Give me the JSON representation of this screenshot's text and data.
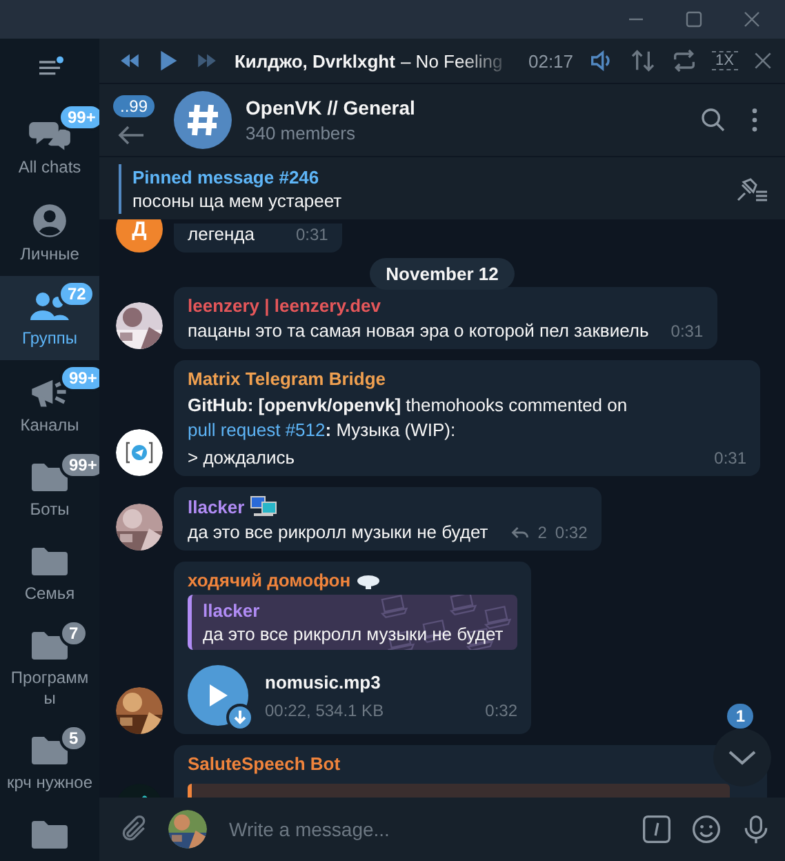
{
  "sidebar": {
    "items": [
      {
        "kind": "chats",
        "label": "All chats",
        "badge": "99+",
        "badge_muted": false,
        "selected": false
      },
      {
        "kind": "person",
        "label": "Личные",
        "selected": false
      },
      {
        "kind": "group",
        "label": "Группы",
        "badge": "72",
        "badge_muted": false,
        "selected": true
      },
      {
        "kind": "channel",
        "label": "Каналы",
        "badge": "99+",
        "badge_muted": false,
        "selected": false
      },
      {
        "kind": "folder",
        "label": "Боты",
        "badge": "99+",
        "badge_muted": true,
        "selected": false
      },
      {
        "kind": "folder",
        "label": "Семья",
        "selected": false
      },
      {
        "kind": "folder",
        "label": "Программы",
        "badge": "7",
        "badge_muted": true,
        "selected": false
      },
      {
        "kind": "folder",
        "label": "крч нужное",
        "badge": "5",
        "badge_muted": true,
        "selected": false
      },
      {
        "kind": "folder",
        "selected": false
      }
    ]
  },
  "player": {
    "track_artist": "Килджо, Dvrklxght",
    "track_title": "– No Feeling",
    "time": "02:17",
    "speed": "1X"
  },
  "chat": {
    "title": "OpenVK // General",
    "subtitle": "340 members",
    "unread": "..99"
  },
  "pinned": {
    "title": "Pinned message #246",
    "text": "посоны ща мем устареет"
  },
  "date": "November 12",
  "messages": [
    {
      "kind": "tail",
      "avatar": {
        "kind": "letter",
        "letter": "Д",
        "color": "#f0842c"
      },
      "text": "легенда",
      "time": "0:31"
    },
    {
      "kind": "date"
    },
    {
      "kind": "text",
      "author": "leenzery | leenzery.dev",
      "color": "#e5575a",
      "text": "пацаны это та самая новая эра о которой пел заквиель",
      "time": "0:31"
    },
    {
      "kind": "rich",
      "avatar": {
        "kind": "bridge"
      },
      "author": "Matrix Telegram Bridge",
      "color": "#f0a050",
      "parts": [
        {
          "kind": "bold",
          "text": "GitHub: [openvk/openvk]"
        },
        {
          "kind": "text",
          "text": " themohooks commented on "
        },
        {
          "kind": "link",
          "text": "pull request #512"
        },
        {
          "kind": "bold",
          "text": ":"
        },
        {
          "kind": "text",
          "text": " Музыка (WIP):"
        }
      ],
      "text": "> дождались",
      "time": "0:31"
    },
    {
      "kind": "text",
      "author": "llacker",
      "author_icon": {
        "kind": "computer"
      },
      "color": "#b18cf5",
      "text": "да это все рикролл музыки не будет",
      "replies": "2",
      "time": "0:32"
    },
    {
      "kind": "audio",
      "author": "ходячий домофон",
      "author_icon": {
        "kind": "cloud"
      },
      "color": "#f0843c",
      "quote": {
        "author": "llacker",
        "text": "да это все рикролл музыки не будет"
      },
      "file": "nomusic.mp3",
      "meta": "00:22, 534.1 KB",
      "time": "0:32"
    },
    {
      "kind": "cut",
      "avatar": {
        "kind": "wave"
      },
      "author": "SaluteSpeech Bot",
      "color": "#f0843c"
    }
  ],
  "scroll_down": {
    "badge": "1"
  },
  "composer": {
    "placeholder": "Write a message..."
  }
}
